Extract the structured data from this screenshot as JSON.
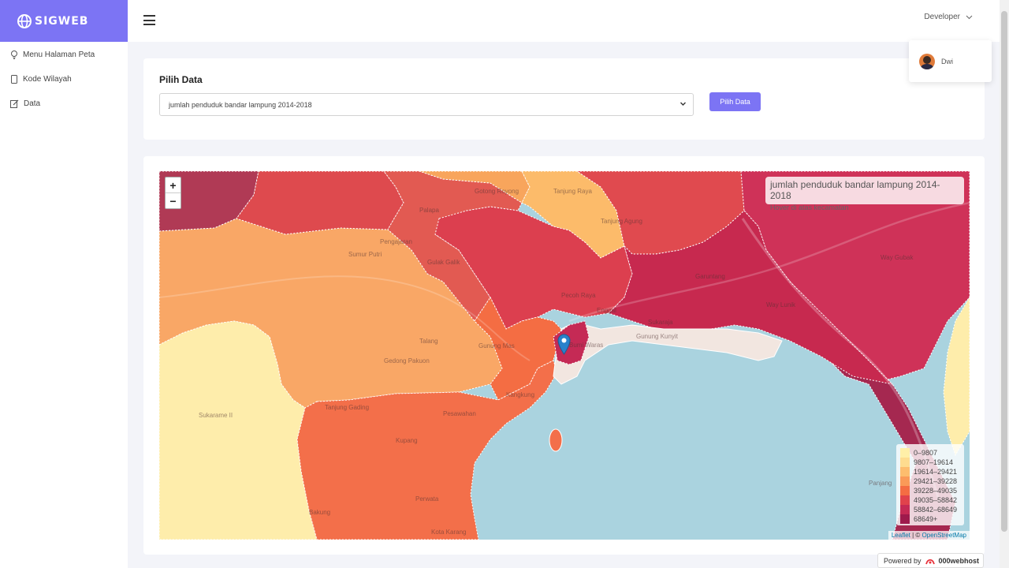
{
  "brand": {
    "name": "SIGWEB"
  },
  "sidebar": {
    "items": [
      {
        "label": "Menu Halaman Peta",
        "icon": "lightbulb-icon"
      },
      {
        "label": "Kode Wilayah",
        "icon": "tablet-icon"
      },
      {
        "label": "Data",
        "icon": "edit-icon"
      }
    ]
  },
  "topbar": {
    "user_label": "Developer"
  },
  "dropdown": {
    "user_name": "Dwi"
  },
  "pilih": {
    "title": "Pilih Data",
    "select_value": "jumlah penduduk bandar lampung 2014-2018",
    "button_label": "Pilih Data"
  },
  "map": {
    "zoom_in": "+",
    "zoom_out": "−",
    "info_title": "jumlah penduduk bandar lampung 2014-2018",
    "info_hint": "Hover di atas kecamatan",
    "attribution_leaflet": "Leaflet",
    "attribution_sep": " | © ",
    "attribution_osm": "OpenStreetMap",
    "place_labels": [
      "Gotong Royong",
      "Tanjung Raya",
      "Palapa",
      "Tanjung Agung",
      "Pengajaran",
      "Sumur Putri",
      "Gulak Galik",
      "Way Gubak",
      "Garuntang",
      "Sukaraja",
      "Way Lunik",
      "Talang",
      "Gedong Pakuon",
      "Kangkung",
      "Pesawahan",
      "Sukarame II",
      "Kupang",
      "Perwata",
      "Kota Karang",
      "Panjang",
      "Pecoh Raya",
      "Gunung Mas",
      "Enggal",
      "Bumi Waras",
      "Bakung",
      "Gunung Kunyit",
      "Tanjung Gading"
    ],
    "legend": [
      {
        "label": "0–9807",
        "color": "#ffefa8"
      },
      {
        "label": "9807–19614",
        "color": "#fedc8f"
      },
      {
        "label": "19614–29421",
        "color": "#fdbd6e"
      },
      {
        "label": "29421–39228",
        "color": "#fa9a58"
      },
      {
        "label": "39228–49035",
        "color": "#f46d43"
      },
      {
        "label": "49035–58842",
        "color": "#e0424c"
      },
      {
        "label": "58842–68649",
        "color": "#c52a55"
      },
      {
        "label": "68649+",
        "color": "#9e1a4c"
      }
    ]
  },
  "footer": {
    "powered_prefix": "Powered by",
    "powered_brand": "000webhost"
  },
  "colors": {
    "accent": "#7c74f4",
    "sea": "#aad3df"
  }
}
